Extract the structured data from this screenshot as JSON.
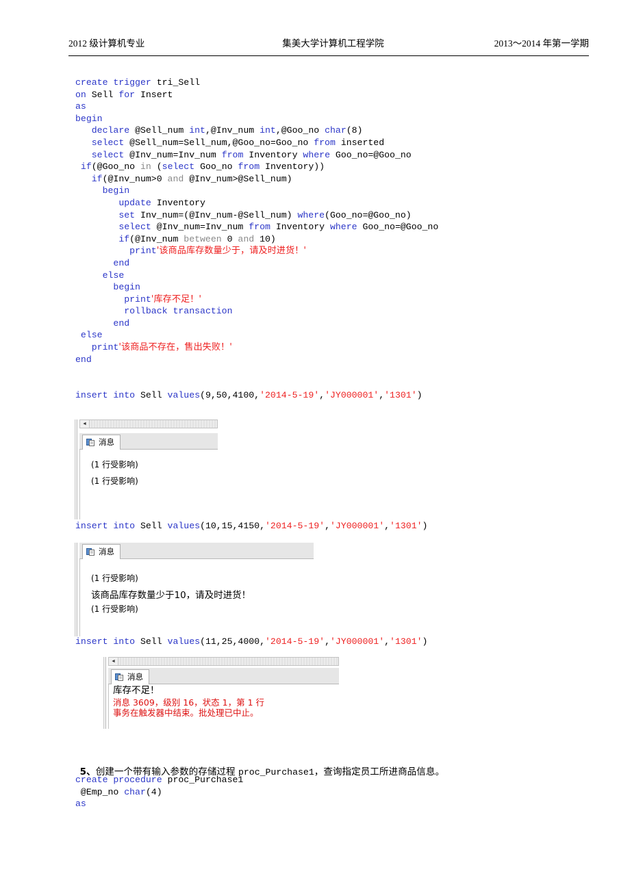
{
  "header": {
    "left": "2012 级计算机专业",
    "center": "集美大学计算机工程学院",
    "right": "2013～2014 年第一学期"
  },
  "trigger_code": {
    "lines": [
      [
        {
          "t": "create trigger ",
          "c": "kw"
        },
        {
          "t": "tri_Sell",
          "c": "pln"
        }
      ],
      [
        {
          "t": "on ",
          "c": "kw"
        },
        {
          "t": "Sell ",
          "c": "pln"
        },
        {
          "t": "for ",
          "c": "kw"
        },
        {
          "t": "Insert",
          "c": "pln"
        }
      ],
      [
        {
          "t": "as",
          "c": "kw"
        }
      ],
      [
        {
          "t": "begin",
          "c": "kw"
        }
      ],
      [
        {
          "t": "   ",
          "c": "pln"
        },
        {
          "t": "declare ",
          "c": "kw"
        },
        {
          "t": "@Sell_num ",
          "c": "pln"
        },
        {
          "t": "int",
          "c": "kw"
        },
        {
          "t": ",@Inv_num ",
          "c": "pln"
        },
        {
          "t": "int",
          "c": "kw"
        },
        {
          "t": ",@Goo_no ",
          "c": "pln"
        },
        {
          "t": "char",
          "c": "kw"
        },
        {
          "t": "(8)",
          "c": "pln"
        }
      ],
      [
        {
          "t": "   ",
          "c": "pln"
        },
        {
          "t": "select ",
          "c": "kw"
        },
        {
          "t": "@Sell_num=Sell_num,@Goo_no=Goo_no ",
          "c": "pln"
        },
        {
          "t": "from ",
          "c": "kw"
        },
        {
          "t": "inserted",
          "c": "pln"
        }
      ],
      [
        {
          "t": "   ",
          "c": "pln"
        },
        {
          "t": "select ",
          "c": "kw"
        },
        {
          "t": "@Inv_num=Inv_num ",
          "c": "pln"
        },
        {
          "t": "from ",
          "c": "kw"
        },
        {
          "t": "Inventory ",
          "c": "pln"
        },
        {
          "t": "where ",
          "c": "kw"
        },
        {
          "t": "Goo_no=@Goo_no",
          "c": "pln"
        }
      ],
      [
        {
          "t": " ",
          "c": "pln"
        },
        {
          "t": "if",
          "c": "kw"
        },
        {
          "t": "(@Goo_no ",
          "c": "pln"
        },
        {
          "t": "in ",
          "c": "kw2"
        },
        {
          "t": "(",
          "c": "pln"
        },
        {
          "t": "select ",
          "c": "kw"
        },
        {
          "t": "Goo_no ",
          "c": "pln"
        },
        {
          "t": "from ",
          "c": "kw"
        },
        {
          "t": "Inventory))",
          "c": "pln"
        }
      ],
      [
        {
          "t": "   ",
          "c": "pln"
        },
        {
          "t": "if",
          "c": "kw"
        },
        {
          "t": "(@Inv_num>0 ",
          "c": "pln"
        },
        {
          "t": "and ",
          "c": "kw2"
        },
        {
          "t": "@Inv_num>@Sell_num)",
          "c": "pln"
        }
      ],
      [
        {
          "t": "     ",
          "c": "pln"
        },
        {
          "t": "begin",
          "c": "kw"
        }
      ],
      [
        {
          "t": "        ",
          "c": "pln"
        },
        {
          "t": "update ",
          "c": "kw"
        },
        {
          "t": "Inventory",
          "c": "pln"
        }
      ],
      [
        {
          "t": "        ",
          "c": "pln"
        },
        {
          "t": "set ",
          "c": "kw"
        },
        {
          "t": "Inv_num=(@Inv_num-@Sell_num) ",
          "c": "pln"
        },
        {
          "t": "where",
          "c": "kw"
        },
        {
          "t": "(Goo_no=@Goo_no)",
          "c": "pln"
        }
      ],
      [
        {
          "t": "        ",
          "c": "pln"
        },
        {
          "t": "select ",
          "c": "kw"
        },
        {
          "t": "@Inv_num=Inv_num ",
          "c": "pln"
        },
        {
          "t": "from ",
          "c": "kw"
        },
        {
          "t": "Inventory ",
          "c": "pln"
        },
        {
          "t": "where ",
          "c": "kw"
        },
        {
          "t": "Goo_no=@Goo_no",
          "c": "pln"
        }
      ],
      [
        {
          "t": "        ",
          "c": "pln"
        },
        {
          "t": "if",
          "c": "kw"
        },
        {
          "t": "(@Inv_num ",
          "c": "pln"
        },
        {
          "t": "between ",
          "c": "kw2"
        },
        {
          "t": "0 ",
          "c": "pln"
        },
        {
          "t": "and ",
          "c": "kw2"
        },
        {
          "t": "10)",
          "c": "pln"
        }
      ],
      [
        {
          "t": "          ",
          "c": "pln"
        },
        {
          "t": "print",
          "c": "kw"
        },
        {
          "t": "'该商品库存数量少于，请及时进货！'",
          "c": "str cn"
        }
      ],
      [
        {
          "t": "       ",
          "c": "pln"
        },
        {
          "t": "end",
          "c": "kw"
        }
      ],
      [
        {
          "t": "     ",
          "c": "pln"
        },
        {
          "t": "else",
          "c": "kw"
        }
      ],
      [
        {
          "t": "       ",
          "c": "pln"
        },
        {
          "t": "begin",
          "c": "kw"
        }
      ],
      [
        {
          "t": "         ",
          "c": "pln"
        },
        {
          "t": "print",
          "c": "kw"
        },
        {
          "t": "'库存不足！'",
          "c": "str cn"
        }
      ],
      [
        {
          "t": "         ",
          "c": "pln"
        },
        {
          "t": "rollback transaction",
          "c": "kw"
        }
      ],
      [
        {
          "t": "       ",
          "c": "pln"
        },
        {
          "t": "end",
          "c": "kw"
        }
      ],
      [
        {
          "t": " ",
          "c": "pln"
        },
        {
          "t": "else",
          "c": "kw"
        }
      ],
      [
        {
          "t": "   ",
          "c": "pln"
        },
        {
          "t": "print",
          "c": "kw"
        },
        {
          "t": "'该商品不存在，售出失败！'",
          "c": "str cn"
        }
      ],
      [
        {
          "t": "end",
          "c": "kw"
        }
      ]
    ]
  },
  "insert1": {
    "lines": [
      [
        {
          "t": "insert into ",
          "c": "kw"
        },
        {
          "t": "Sell ",
          "c": "pln"
        },
        {
          "t": "values",
          "c": "kw"
        },
        {
          "t": "(9,50,4100,",
          "c": "pln"
        },
        {
          "t": "'2014-5-19'",
          "c": "str"
        },
        {
          "t": ",",
          "c": "pln"
        },
        {
          "t": "'JY000001'",
          "c": "str"
        },
        {
          "t": ",",
          "c": "pln"
        },
        {
          "t": "'1301'",
          "c": "str"
        },
        {
          "t": ")",
          "c": "pln"
        }
      ]
    ]
  },
  "insert2": {
    "lines": [
      [
        {
          "t": "insert into ",
          "c": "kw"
        },
        {
          "t": "Sell ",
          "c": "pln"
        },
        {
          "t": "values",
          "c": "kw"
        },
        {
          "t": "(10,15,4150,",
          "c": "pln"
        },
        {
          "t": "'2014-5-19'",
          "c": "str"
        },
        {
          "t": ",",
          "c": "pln"
        },
        {
          "t": "'JY000001'",
          "c": "str"
        },
        {
          "t": ",",
          "c": "pln"
        },
        {
          "t": "'1301'",
          "c": "str"
        },
        {
          "t": ")",
          "c": "pln"
        }
      ]
    ]
  },
  "insert3": {
    "lines": [
      [
        {
          "t": "insert into ",
          "c": "kw"
        },
        {
          "t": "Sell ",
          "c": "pln"
        },
        {
          "t": "values",
          "c": "kw"
        },
        {
          "t": "(11,25,4000,",
          "c": "pln"
        },
        {
          "t": "'2014-5-19'",
          "c": "str"
        },
        {
          "t": ",",
          "c": "pln"
        },
        {
          "t": "'JY000001'",
          "c": "str"
        },
        {
          "t": ",",
          "c": "pln"
        },
        {
          "t": "'1301'",
          "c": "str"
        },
        {
          "t": ")",
          "c": "pln"
        }
      ]
    ]
  },
  "panel1": {
    "tab_label": "消息",
    "messages": [
      {
        "text": "(1 行受影响)",
        "style": "rows"
      },
      {
        "text": "(1 行受影响)",
        "style": "rows"
      }
    ]
  },
  "panel2": {
    "tab_label": "消息",
    "messages": [
      {
        "text": "(1 行受影响)",
        "style": "rows"
      },
      {
        "text": "该商品库存数量少于10，请及时进货！",
        "style": "text"
      },
      {
        "text": "(1 行受影响)",
        "style": "rows"
      }
    ]
  },
  "panel3": {
    "tab_label": "消息",
    "messages": [
      {
        "text": "库存不足！",
        "style": "black"
      },
      {
        "text": "消息 3609，级别 16，状态 1，第 1 行",
        "style": "err"
      },
      {
        "text": "事务在触发器中结束。批处理已中止。",
        "style": "err"
      }
    ]
  },
  "question5": {
    "number": "5、",
    "text_before": "创建一个带有输入参数的存储过程 ",
    "code_name": "proc_Purchase1",
    "text_after": "，查询指定员工所进商品信息。"
  },
  "proc_code": {
    "lines": [
      [
        {
          "t": "create procedure ",
          "c": "kw"
        },
        {
          "t": "proc_Purchase1",
          "c": "pln"
        }
      ],
      [
        {
          "t": " @Emp_no ",
          "c": "pln"
        },
        {
          "t": "char",
          "c": "kw"
        },
        {
          "t": "(4)",
          "c": "pln"
        }
      ],
      [
        {
          "t": "as",
          "c": "kw"
        }
      ]
    ]
  },
  "colors": {
    "keyword": "#2b36c8",
    "operator": "#8a8a8a",
    "string": "#ee2222",
    "error": "#dd1111"
  }
}
